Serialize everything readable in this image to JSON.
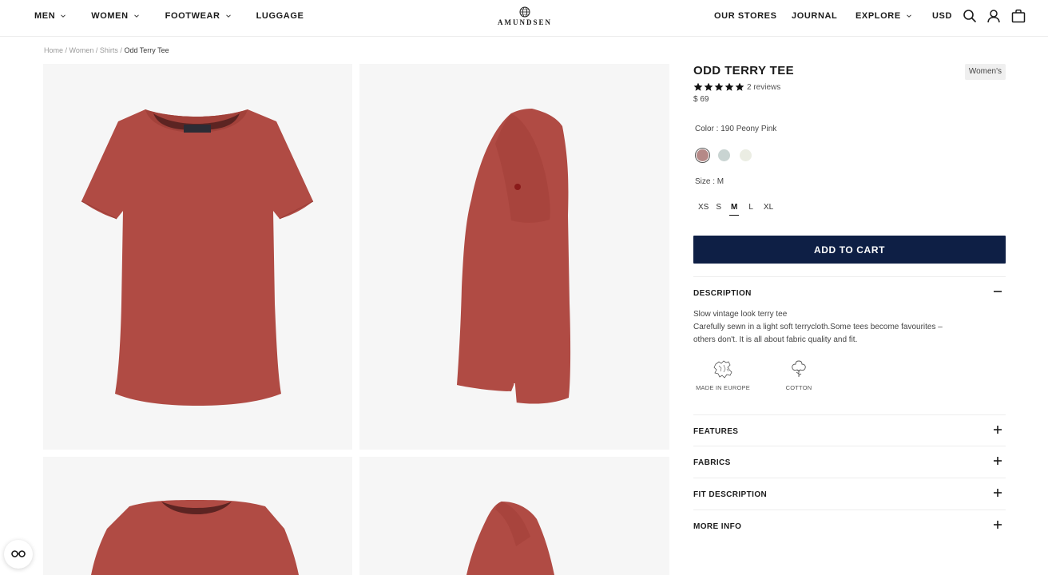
{
  "header": {
    "nav_left": [
      {
        "label": "MEN",
        "has_dropdown": true
      },
      {
        "label": "WOMEN",
        "has_dropdown": true
      },
      {
        "label": "FOOTWEAR",
        "has_dropdown": true
      },
      {
        "label": "LUGGAGE",
        "has_dropdown": false
      }
    ],
    "logo_text": "AMUNDSEN",
    "nav_right": [
      {
        "label": "OUR STORES"
      },
      {
        "label": "JOURNAL"
      },
      {
        "label": "EXPLORE",
        "has_dropdown": true
      },
      {
        "label": "USD"
      }
    ],
    "icons": [
      "search-icon",
      "account-icon",
      "bag-icon"
    ]
  },
  "breadcrumb": {
    "items": [
      "Home",
      "Women",
      "Shirts"
    ],
    "separator": " / ",
    "current": "Odd Terry Tee"
  },
  "gallery": {
    "images": [
      "front-view",
      "side-view",
      "front-detail",
      "side-detail"
    ],
    "shirt_color": "#b04b44"
  },
  "product": {
    "title": "ODD TERRY TEE",
    "tag": "Women's",
    "rating": 5,
    "reviews": "2 reviews",
    "price": "$ 69",
    "color_label": "Color : 190 Peony Pink",
    "colors": [
      {
        "hex": "#b58987",
        "selected": true
      },
      {
        "hex": "#c9d4d2",
        "selected": false
      },
      {
        "hex": "#ebede3",
        "selected": false
      }
    ],
    "size_label": "Size : M",
    "sizes": [
      {
        "label": "XS",
        "selected": false
      },
      {
        "label": "S",
        "selected": false
      },
      {
        "label": "M",
        "selected": true
      },
      {
        "label": "L",
        "selected": false
      },
      {
        "label": "XL",
        "selected": false
      }
    ],
    "add_to_cart": "ADD TO CART",
    "accent_color": "#0e1f45"
  },
  "description": {
    "heading": "DESCRIPTION",
    "line1": "Slow vintage look terry tee",
    "line2": "Carefully sewn in a light soft terrycloth.Some tees become favourites –",
    "line3": "others don't. It is all about fabric quality and fit.",
    "badges": [
      {
        "icon": "europe-map-icon",
        "label": "MADE IN EUROPE"
      },
      {
        "icon": "cotton-icon",
        "label": "COTTON"
      }
    ]
  },
  "accordions": [
    {
      "label": "FEATURES"
    },
    {
      "label": "FABRICS"
    },
    {
      "label": "FIT DESCRIPTION"
    },
    {
      "label": "MORE INFO"
    }
  ]
}
